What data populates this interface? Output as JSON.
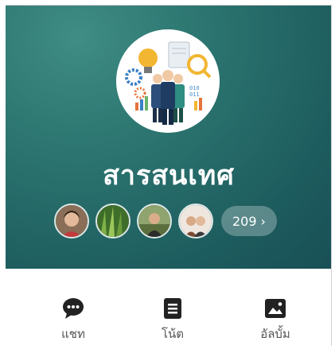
{
  "group": {
    "name": "สารสนเทศ",
    "cover_icon": "business-team-data-illustration",
    "member_count_label": "209",
    "member_chevron": "›",
    "member_avatars": [
      "woman-smiling-avatar",
      "green-grass-avatar",
      "person-outdoors-avatar",
      "two-people-avatar"
    ]
  },
  "actions": [
    {
      "icon": "chat-bubble-icon",
      "label": "แชท"
    },
    {
      "icon": "note-icon",
      "label": "โน้ต"
    },
    {
      "icon": "album-icon",
      "label": "อัลบั้ม"
    }
  ],
  "colors": {
    "header_bg": "#226866",
    "action_icon": "#222222",
    "action_label": "#555555"
  }
}
